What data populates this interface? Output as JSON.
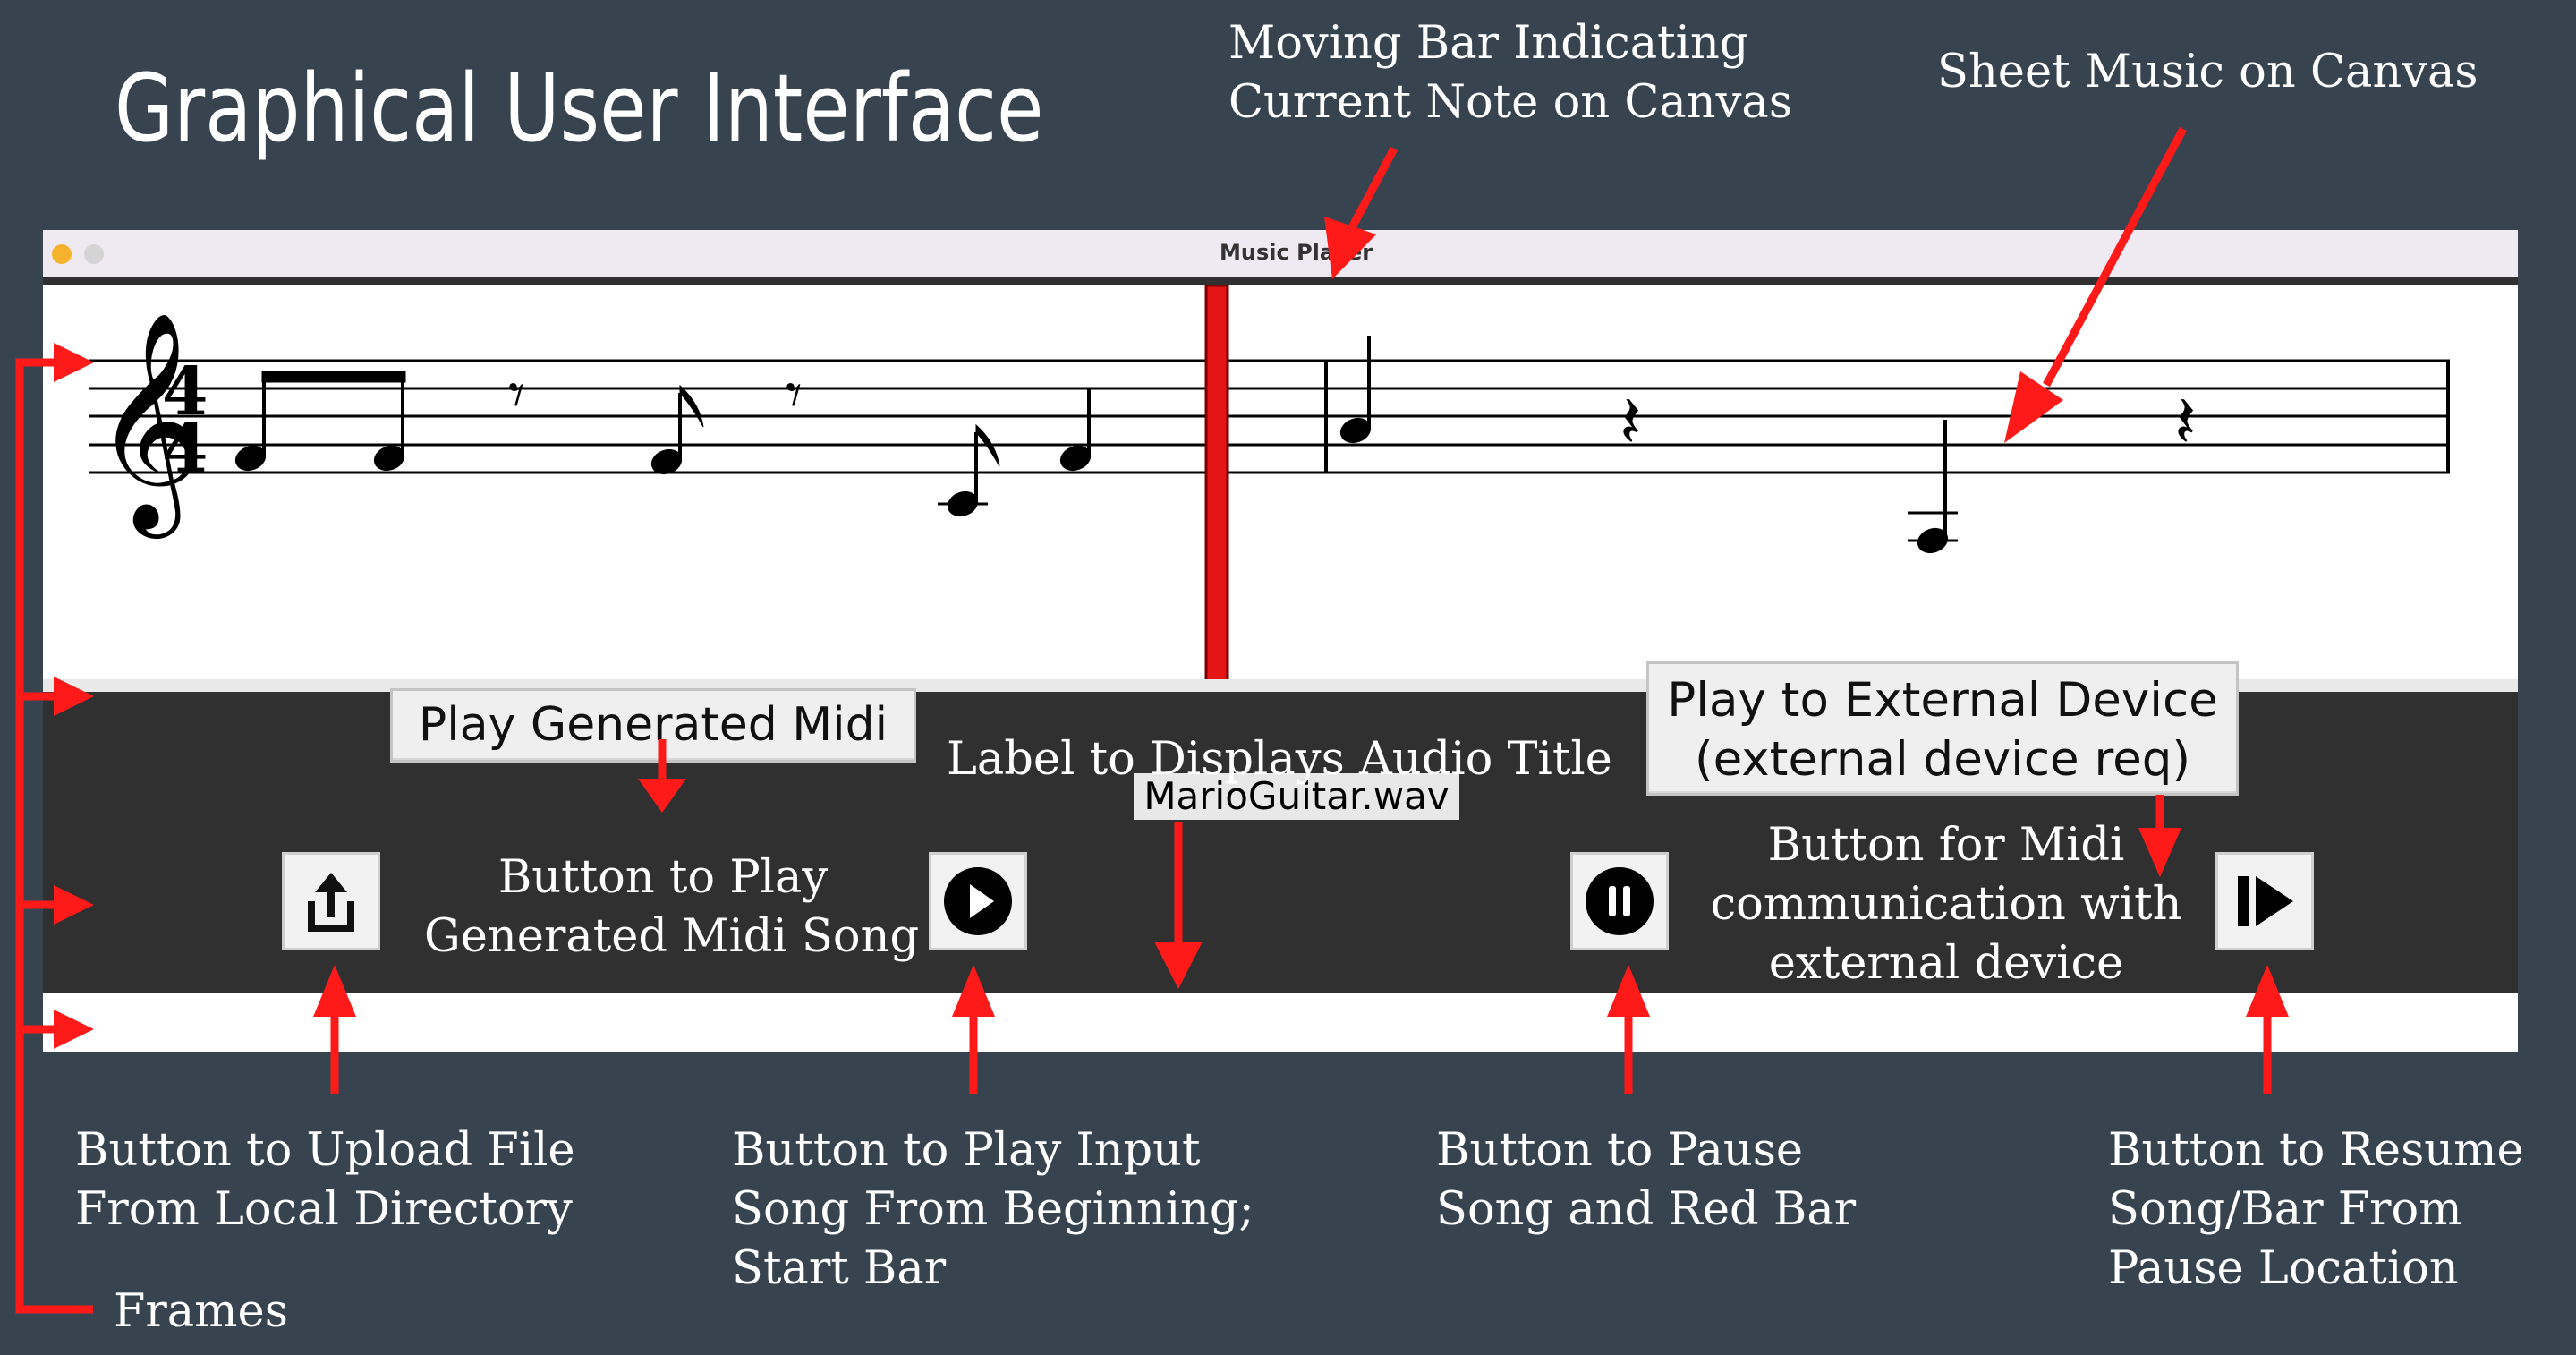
{
  "slide": {
    "title": "Graphical User Interface"
  },
  "window": {
    "title": "Music Player",
    "audio_title": "MarioGuitar.wav"
  },
  "controls": {
    "play_generated_midi": "Play Generated Midi",
    "play_external_line1": "Play to External Device",
    "play_external_line2": "(external device req)",
    "upload_icon": "upload-icon",
    "play_icon": "play-icon",
    "pause_icon": "pause-icon",
    "resume_icon": "resume-icon"
  },
  "annotations": {
    "moving_bar_line1": "Moving Bar Indicating",
    "moving_bar_line2": "Current Note on Canvas",
    "sheet_music": "Sheet Music on Canvas",
    "play_midi_line1": "Button to Play",
    "play_midi_line2": "Generated Midi Song",
    "label_title": "Label to Displays Audio Title",
    "midi_comm_line1": "Button for Midi",
    "midi_comm_line2": "communication with",
    "midi_comm_line3": "external device",
    "upload_line1": "Button to Upload File",
    "upload_line2": "From Local Directory",
    "play_input_line1": "Button to  Play Input",
    "play_input_line2": "Song From Beginning;",
    "play_input_line3": "Start Bar",
    "pause_line1": "Button to  Pause",
    "pause_line2": "Song and Red Bar",
    "resume_line1": "Button to  Resume",
    "resume_line2": "Song/Bar From",
    "resume_line3": "Pause Location",
    "frames": "Frames"
  },
  "colors": {
    "slide_background": "#37444f",
    "arrow": "#ff1a1a",
    "progress_bar": "#e51515",
    "frame_dark": "#303030"
  },
  "score": {
    "time_signature_top": "4",
    "time_signature_bottom": "4"
  }
}
